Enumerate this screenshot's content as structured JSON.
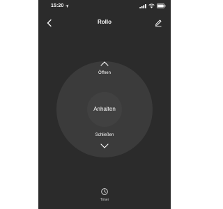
{
  "status_bar": {
    "time": "15:20"
  },
  "header": {
    "title": "Rollo"
  },
  "remote": {
    "up_label": "Öffnen",
    "stop_label": "Anhalten",
    "down_label": "Schließen"
  },
  "footer": {
    "timer_label": "Timer"
  },
  "icons": {
    "back": "chevron-left-icon",
    "edit": "pencil-icon",
    "up": "chevron-up-icon",
    "down": "chevron-down-icon",
    "timer": "clock-icon",
    "location": "location-arrow-icon",
    "signal": "cellular-signal-icon",
    "wifi": "wifi-icon",
    "battery": "battery-icon"
  },
  "colors": {
    "background": "#2b2b2b",
    "ring": "#3b3b3b",
    "center": "#414141",
    "text": "#ffffff"
  }
}
